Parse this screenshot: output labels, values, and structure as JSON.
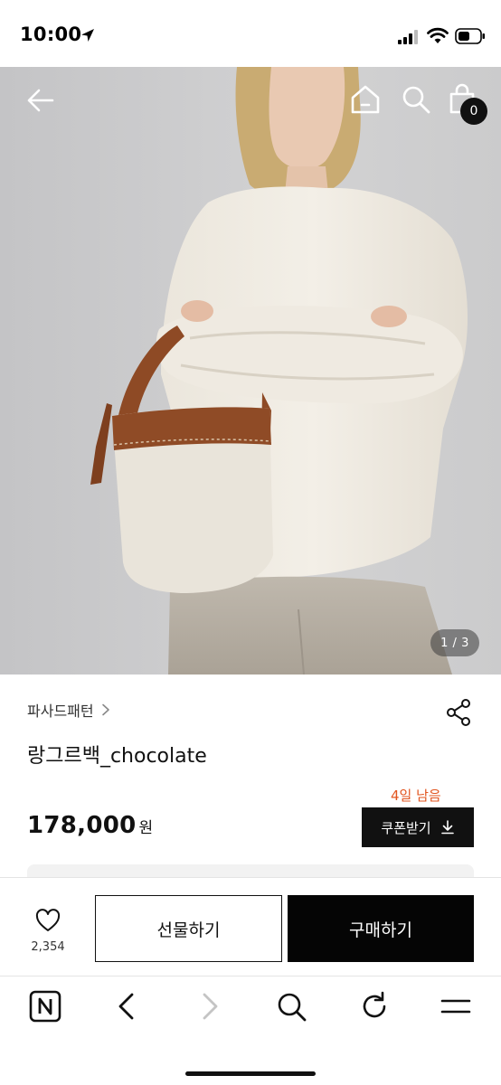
{
  "status_bar": {
    "time": "10:00"
  },
  "icons": {
    "location": "location-arrow-icon",
    "signal": "cellular-signal-icon",
    "wifi": "wifi-icon",
    "battery": "battery-icon",
    "back": "back-arrow-icon",
    "home": "home-icon",
    "search": "search-icon",
    "bag": "shopping-bag-icon",
    "share": "share-icon",
    "heart": "heart-icon",
    "download": "download-icon"
  },
  "header": {
    "cart_count": "0"
  },
  "gallery": {
    "indicator": "1 / 3"
  },
  "product": {
    "brand": "파사드패턴",
    "title": "랑그르백_chocolate",
    "price": "178,000",
    "currency": "원",
    "coupon_days_left": "4일 남음",
    "coupon_label": "쿠폰받기"
  },
  "actions": {
    "like_count": "2,354",
    "gift_label": "선물하기",
    "buy_label": "구매하기"
  },
  "browser_toolbar": {
    "items": [
      "naver-n-icon",
      "back-chevron-icon",
      "forward-chevron-icon",
      "search-icon",
      "refresh-icon",
      "menu-icon"
    ]
  },
  "colors": {
    "accent": "#e2551f",
    "primary": "#111111"
  }
}
